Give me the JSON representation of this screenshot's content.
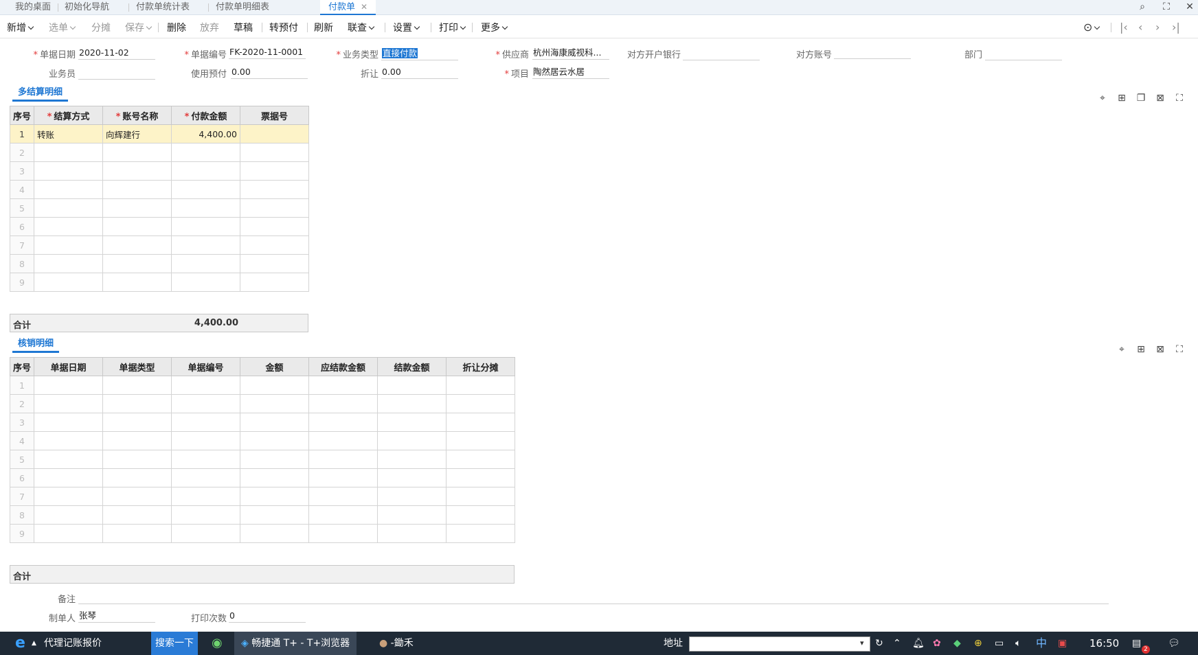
{
  "tabs": [
    "我的桌面",
    "初始化导航",
    "付款单统计表",
    "付款单明细表",
    "付款单"
  ],
  "toolbar": {
    "new": "新增",
    "select": "选单",
    "share": "分摊",
    "save": "保存",
    "delete": "删除",
    "discard": "放弃",
    "draft": "草稿",
    "to_prepay": "转预付",
    "refresh": "刷新",
    "link": "联查",
    "settings": "设置",
    "print": "打印",
    "more": "更多"
  },
  "form": {
    "date_label": "单据日期",
    "date": "2020-11-02",
    "code_label": "单据编号",
    "code": "FK-2020-11-0001",
    "biz_type_label": "业务类型",
    "biz_type": "直接付款",
    "supplier_label": "供应商",
    "supplier": "杭州海康威视科...",
    "bank_label": "对方开户银行",
    "bank": "",
    "account_label": "对方账号",
    "account": "",
    "dept_label": "部门",
    "dept": "",
    "staff_label": "业务员",
    "staff": "",
    "prepay_label": "使用预付",
    "prepay": "0.00",
    "discount_label": "折让",
    "discount": "0.00",
    "project_label": "项目",
    "project": "陶然居云水居"
  },
  "settle": {
    "title": "多结算明细",
    "headers": [
      "序号",
      "结算方式",
      "账号名称",
      "付款金额",
      "票据号"
    ],
    "rows": [
      [
        "1",
        "转账",
        "向辉建行",
        "4,400.00",
        ""
      ],
      [
        "2",
        "",
        "",
        "",
        ""
      ],
      [
        "3",
        "",
        "",
        "",
        ""
      ],
      [
        "4",
        "",
        "",
        "",
        ""
      ],
      [
        "5",
        "",
        "",
        "",
        ""
      ],
      [
        "6",
        "",
        "",
        "",
        ""
      ],
      [
        "7",
        "",
        "",
        "",
        ""
      ],
      [
        "8",
        "",
        "",
        "",
        ""
      ],
      [
        "9",
        "",
        "",
        "",
        ""
      ]
    ],
    "total_label": "合计",
    "total": "4,400.00"
  },
  "verify": {
    "title": "核销明细",
    "headers": [
      "序号",
      "单据日期",
      "单据类型",
      "单据编号",
      "金额",
      "应结款金额",
      "结款金额",
      "折让分摊"
    ],
    "rows": [
      [
        "1"
      ],
      [
        "2"
      ],
      [
        "3"
      ],
      [
        "4"
      ],
      [
        "5"
      ],
      [
        "6"
      ],
      [
        "7"
      ],
      [
        "8"
      ],
      [
        "9"
      ]
    ],
    "total_label": "合计"
  },
  "footer": {
    "remark_label": "备注",
    "remark": "",
    "maker_label": "制单人",
    "maker": "张琴",
    "print_count_label": "打印次数",
    "print_count": "0"
  },
  "taskbar": {
    "app": "代理记账报价",
    "search": "搜索一下",
    "browser": "畅捷通 T+ - T+浏览器",
    "user": "-鋤禾",
    "address_label": "地址",
    "ime": "中",
    "time": "16:50",
    "badge": "2"
  },
  "colors": {
    "accent": "#1e77d3",
    "required": "#e23b3b",
    "selected_row": "#fdf3c8"
  }
}
